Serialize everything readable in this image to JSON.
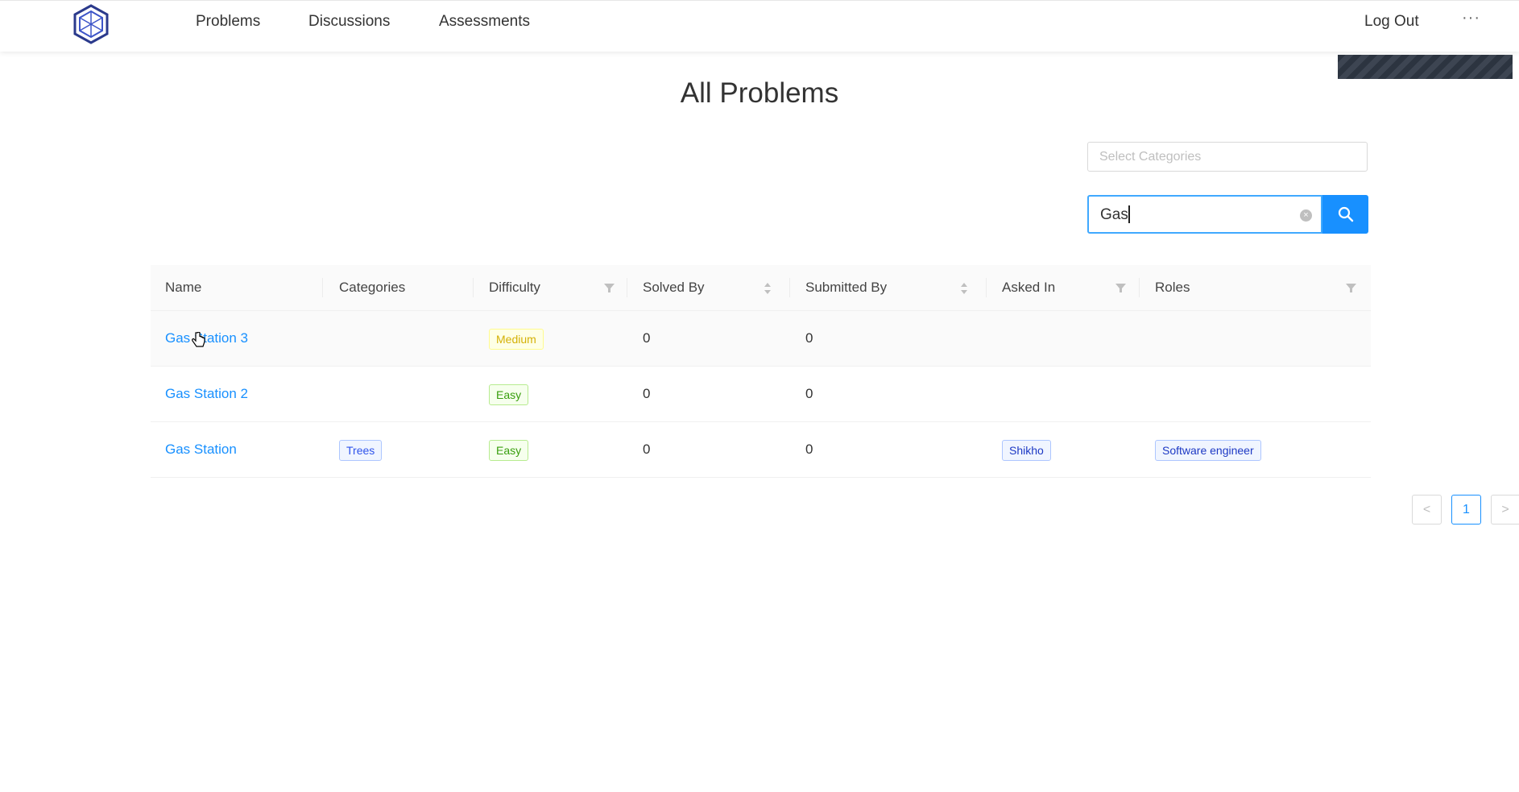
{
  "nav": {
    "items": [
      {
        "label": "Problems"
      },
      {
        "label": "Discussions"
      },
      {
        "label": "Assessments"
      }
    ],
    "logout": "Log Out",
    "more": "···"
  },
  "page": {
    "title": "All Problems"
  },
  "filters": {
    "categories_placeholder": "Select Categories",
    "search_value": "Gas"
  },
  "table": {
    "columns": [
      "Name",
      "Categories",
      "Difficulty",
      "Solved By",
      "Submitted By",
      "Asked In",
      "Roles"
    ],
    "rows": [
      {
        "name": "Gas Station 3",
        "categories": "",
        "difficulty": "Medium",
        "solved_by": "0",
        "submitted_by": "0",
        "asked_in": "",
        "roles": ""
      },
      {
        "name": "Gas Station 2",
        "categories": "",
        "difficulty": "Easy",
        "solved_by": "0",
        "submitted_by": "0",
        "asked_in": "",
        "roles": ""
      },
      {
        "name": "Gas Station",
        "categories": "Trees",
        "difficulty": "Easy",
        "solved_by": "0",
        "submitted_by": "0",
        "asked_in": "Shikho",
        "roles": "Software engineer"
      }
    ]
  },
  "pagination": {
    "prev": "<",
    "current": "1",
    "next": ">"
  },
  "colors": {
    "accent": "#1890ff",
    "medium": "#d4b106",
    "easy": "#389e0d"
  }
}
